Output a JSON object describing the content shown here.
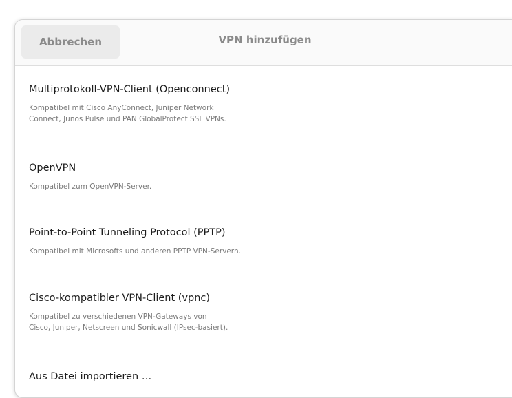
{
  "header": {
    "cancel_label": "Abbrechen",
    "title": "VPN hinzufügen"
  },
  "vpn_types": [
    {
      "title": "Multiprotokoll-VPN-Client (Openconnect)",
      "description": "Kompatibel mit Cisco AnyConnect, Juniper Network\nConnect, Junos Pulse und PAN GlobalProtect SSL VPNs."
    },
    {
      "title": "OpenVPN",
      "description": "Kompatibel zum OpenVPN-Server."
    },
    {
      "title": "Point-to-Point Tunneling Protocol (PPTP)",
      "description": "Kompatibel mit Microsofts und anderen PPTP VPN-Servern."
    },
    {
      "title": "Cisco-kompatibler VPN-Client (vpnc)",
      "description": "Kompatibel zu verschiedenen VPN-Gateways von\nCisco, Juniper, Netscreen und Sonicwall (IPsec-basiert)."
    }
  ],
  "import": {
    "label": "Aus Datei importieren …"
  }
}
